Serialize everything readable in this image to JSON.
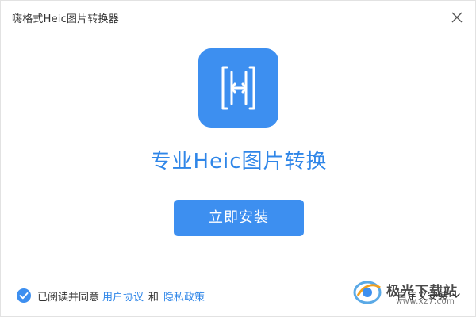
{
  "window": {
    "title": "嗨格式Heic图片转换器"
  },
  "main": {
    "headline": "专业Heic图片转换",
    "install_label": "立即安装"
  },
  "footer": {
    "agree_prefix": "已阅读并同意",
    "user_agreement": "用户协议",
    "and": "和",
    "privacy_policy": "隐私政策",
    "custom_install": "自定义安装"
  },
  "watermark": {
    "brand": "极光下载站",
    "site": "www.xz7.com"
  },
  "icons": {
    "close": "close-icon",
    "logo": "app-logo-icon",
    "check": "checkmark-icon",
    "chevron": "chevron-down-icon"
  },
  "colors": {
    "accent": "#3d8ff0",
    "link": "#2f86e8",
    "text": "#333333",
    "background": "#ffffff"
  }
}
